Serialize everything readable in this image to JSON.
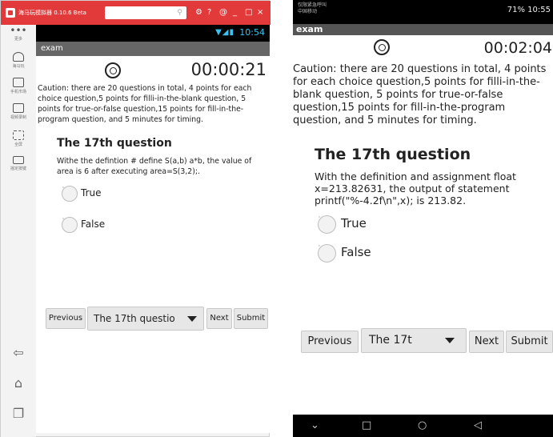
{
  "emulator": {
    "title": "海马玩模拟器 0.10.6 Beta",
    "sidebar": [
      {
        "label": "更多"
      },
      {
        "label": "海马玩"
      },
      {
        "label": "手机市场"
      },
      {
        "label": "视频录制"
      },
      {
        "label": "全屏"
      },
      {
        "label": "摇定按键"
      }
    ],
    "status_time": "10:54"
  },
  "phone": {
    "carrier_line1": "仅限紧急呼叫",
    "carrier_line2": "中国移动",
    "status_right": "71%  10:55"
  },
  "exam": {
    "app_title": "exam",
    "left_timer": "00:00:21",
    "right_timer": "00:02:04",
    "caution": "Caution: there are 20 questions in total, 4 points for each choice question,5 points for filli-in-the-blank question, 5 points for true-or-false question,15 points for fill-in-the-program question, and 5 minutes for timing.",
    "left_question_title": "The 17th question",
    "left_question_text": "Withe the defintion # define S(a,b) a*b, the value of area is 6 after executing area=S(3,2);.",
    "right_question_title": "The 17th question",
    "right_question_text": "With the definition and assignment float x=213.82631, the output of statement printf(\"%-4.2f\\n\",x); is 213.82.",
    "option_true": "True",
    "option_false": "False",
    "previous_label": "Previous",
    "left_spinner_value": "The 17th questio",
    "right_spinner_value": "The 17t",
    "next_label": "Next",
    "submit_label": "Submit"
  }
}
